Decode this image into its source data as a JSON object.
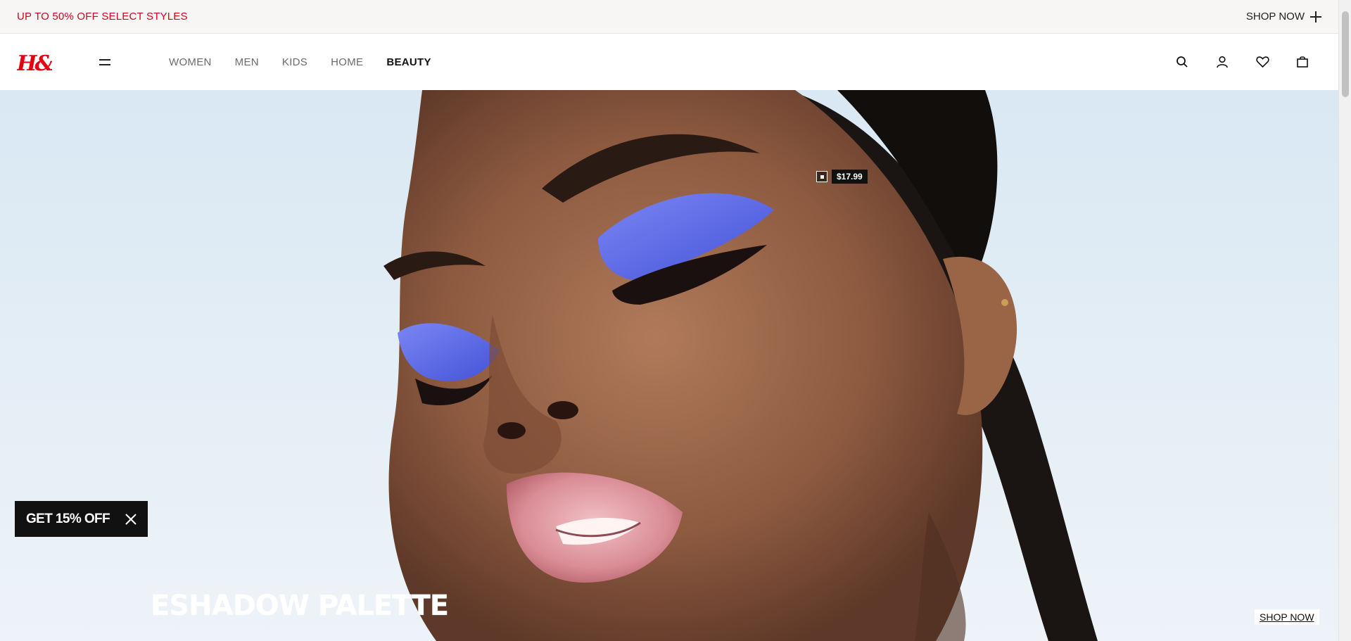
{
  "promo": {
    "text": "UP TO 50% OFF SELECT STYLES",
    "cta_label": "SHOP NOW",
    "cta_icon": "plus-icon",
    "text_color": "#d6001c"
  },
  "header": {
    "logo_text": "H&M",
    "logo_color": "#e50010",
    "menu_icon": "hamburger-icon",
    "nav": [
      {
        "label": "WOMEN",
        "active": false
      },
      {
        "label": "MEN",
        "active": false
      },
      {
        "label": "KIDS",
        "active": false
      },
      {
        "label": "HOME",
        "active": false
      },
      {
        "label": "BEAUTY",
        "active": true
      }
    ],
    "icons": [
      "search-icon",
      "account-icon",
      "favorites-icon",
      "bag-icon"
    ]
  },
  "hero": {
    "price_tag": "$17.99",
    "title": "ESHADOW PALETTE",
    "cta_label": "SHOP NOW",
    "background": "#dde9f3",
    "eyeshadow_color": "#5d6bea"
  },
  "discount_banner": {
    "label": "GET 15% OFF",
    "close_icon": "close-icon"
  }
}
